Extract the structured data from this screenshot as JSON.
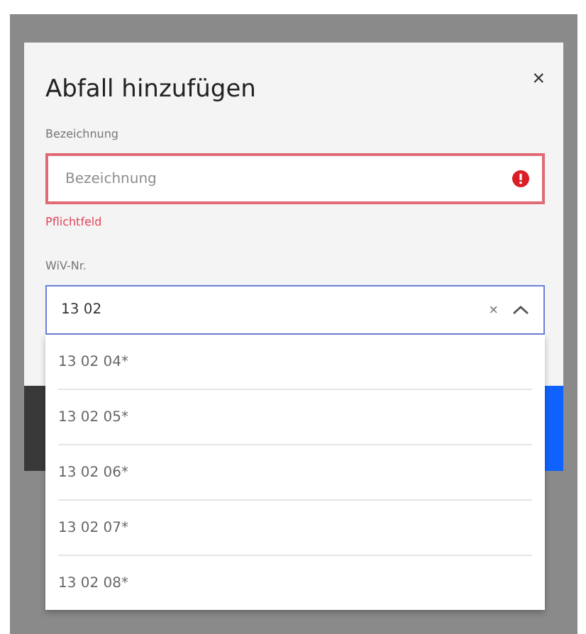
{
  "dialog": {
    "title": "Abfall hinzufügen",
    "close": "×"
  },
  "name_field": {
    "label": "Bezeichnung",
    "placeholder": "Bezeichnung",
    "invalid": true,
    "error": "Pflichtfeld"
  },
  "code_field": {
    "label": "WiV-Nr.",
    "value": "13 02",
    "expanded": true,
    "clear": "×",
    "options": [
      "13 02 04*",
      "13 02 05*",
      "13 02 06*",
      "13 02 07*",
      "13 02 08*"
    ]
  }
}
